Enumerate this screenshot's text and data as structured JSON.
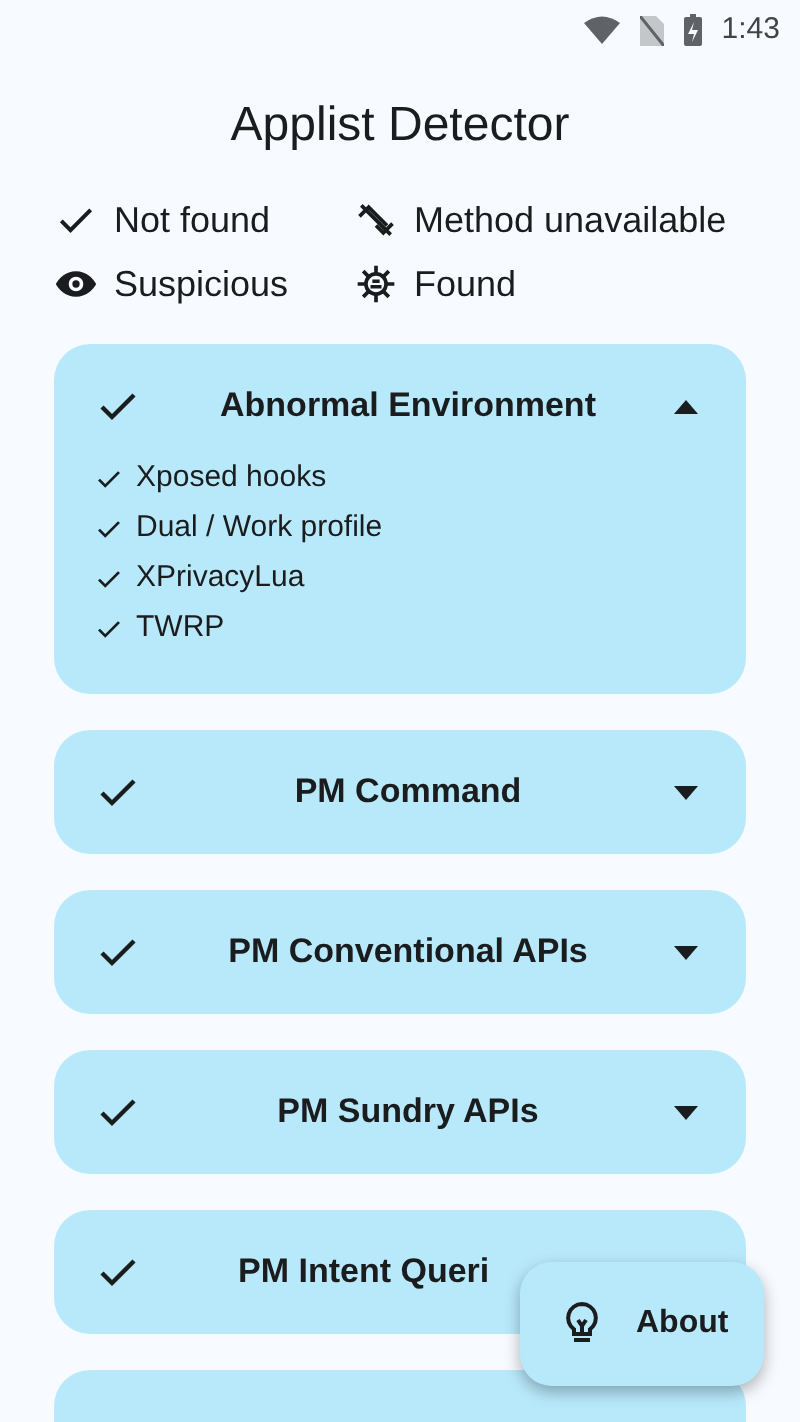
{
  "status_bar": {
    "time": "1:43"
  },
  "title": "Applist Detector",
  "legend": [
    {
      "kind": "not_found",
      "label": "Not found"
    },
    {
      "kind": "unavailable",
      "label": "Method unavailable"
    },
    {
      "kind": "suspicious",
      "label": "Suspicious"
    },
    {
      "kind": "found",
      "label": "Found"
    }
  ],
  "cards": [
    {
      "title": "Abnormal Environment",
      "kind": "not_found",
      "expanded": true,
      "items": [
        {
          "label": "Xposed hooks",
          "kind": "not_found"
        },
        {
          "label": "Dual / Work profile",
          "kind": "not_found"
        },
        {
          "label": "XPrivacyLua",
          "kind": "not_found"
        },
        {
          "label": "TWRP",
          "kind": "not_found"
        }
      ]
    },
    {
      "title": "PM Command",
      "kind": "not_found",
      "expanded": false
    },
    {
      "title": "PM Conventional APIs",
      "kind": "not_found",
      "expanded": false
    },
    {
      "title": "PM Sundry APIs",
      "kind": "not_found",
      "expanded": false
    },
    {
      "title": "PM Intent Queri",
      "kind": "not_found"
    }
  ],
  "fab": {
    "label": "About"
  }
}
